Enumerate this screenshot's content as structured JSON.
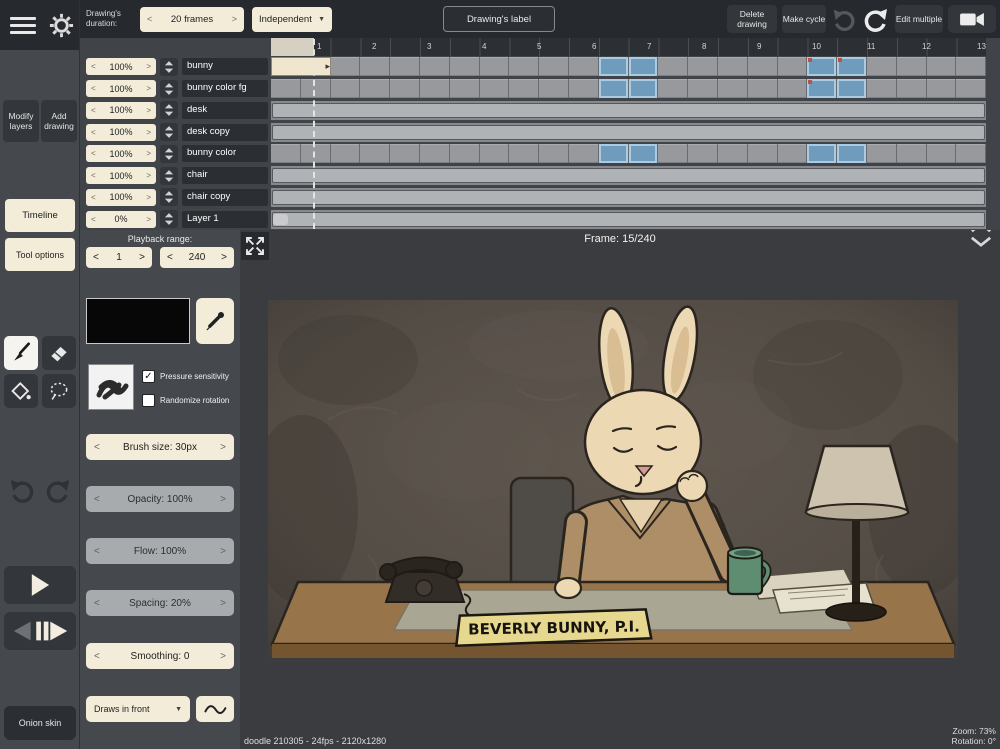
{
  "glyphs": {
    "prev": "<",
    "next": ">",
    "down": "▼",
    "check": "✓",
    "block_arrow": "▸"
  },
  "topbar": {
    "duration_label": "Drawing's duration:",
    "duration_value": "20 frames",
    "independent": "Independent",
    "drawings_label": "Drawing's label",
    "delete_drawing": "Delete drawing",
    "make_cycle": "Make cycle",
    "edit_multiple": "Edit multiple"
  },
  "sidebar": {
    "modify_layers": "Modify layers",
    "add_drawing": "Add drawing",
    "timeline_tab": "Timeline",
    "tool_options_tab": "Tool options",
    "onion_skin": "Onion skin"
  },
  "timeline": {
    "frame_cells": 24,
    "ruler_numbers": [
      "1",
      "2",
      "3",
      "4",
      "5",
      "6",
      "7",
      "8",
      "9",
      "10",
      "11",
      "12",
      "13"
    ],
    "layers": [
      {
        "opacity": "100%",
        "name": "bunny",
        "track": "frames",
        "keys": [
          11,
          12,
          18,
          19
        ],
        "marks": [
          18,
          19
        ],
        "current_block": true
      },
      {
        "opacity": "100%",
        "name": "bunny color fg",
        "track": "frames",
        "keys": [
          11,
          12,
          18,
          19
        ],
        "marks": [
          18
        ]
      },
      {
        "opacity": "100%",
        "name": "desk",
        "track": "single"
      },
      {
        "opacity": "100%",
        "name": "desk copy",
        "track": "single"
      },
      {
        "opacity": "100%",
        "name": "bunny color",
        "track": "frames",
        "keys": [
          11,
          12,
          18,
          19
        ],
        "marks": []
      },
      {
        "opacity": "100%",
        "name": "chair",
        "track": "single"
      },
      {
        "opacity": "100%",
        "name": "chair copy",
        "track": "single"
      },
      {
        "opacity": "0%",
        "name": "Layer 1",
        "track": "single",
        "scroll_handle": true
      }
    ],
    "playback_range_label": "Playback range:",
    "range_start": "1",
    "range_end": "240",
    "frame_label": "Frame: 15/240"
  },
  "tool_options": {
    "pressure_sensitivity": "Pressure sensitivity",
    "randomize_rotation": "Randomize rotation",
    "brush_size": "Brush size:  30px",
    "opacity": "Opacity:  100%",
    "flow": "Flow:  100%",
    "spacing": "Spacing:  20%",
    "smoothing": "Smoothing:  0",
    "draws_in_front": "Draws in front"
  },
  "canvas": {
    "nameplate": "BEVERLY BUNNY, P.I."
  },
  "statusbar": {
    "file_info": "doodle 210305 - 24fps - 2120x1280",
    "zoom": "Zoom: 73%",
    "rotation": "Rotation: 0°"
  }
}
